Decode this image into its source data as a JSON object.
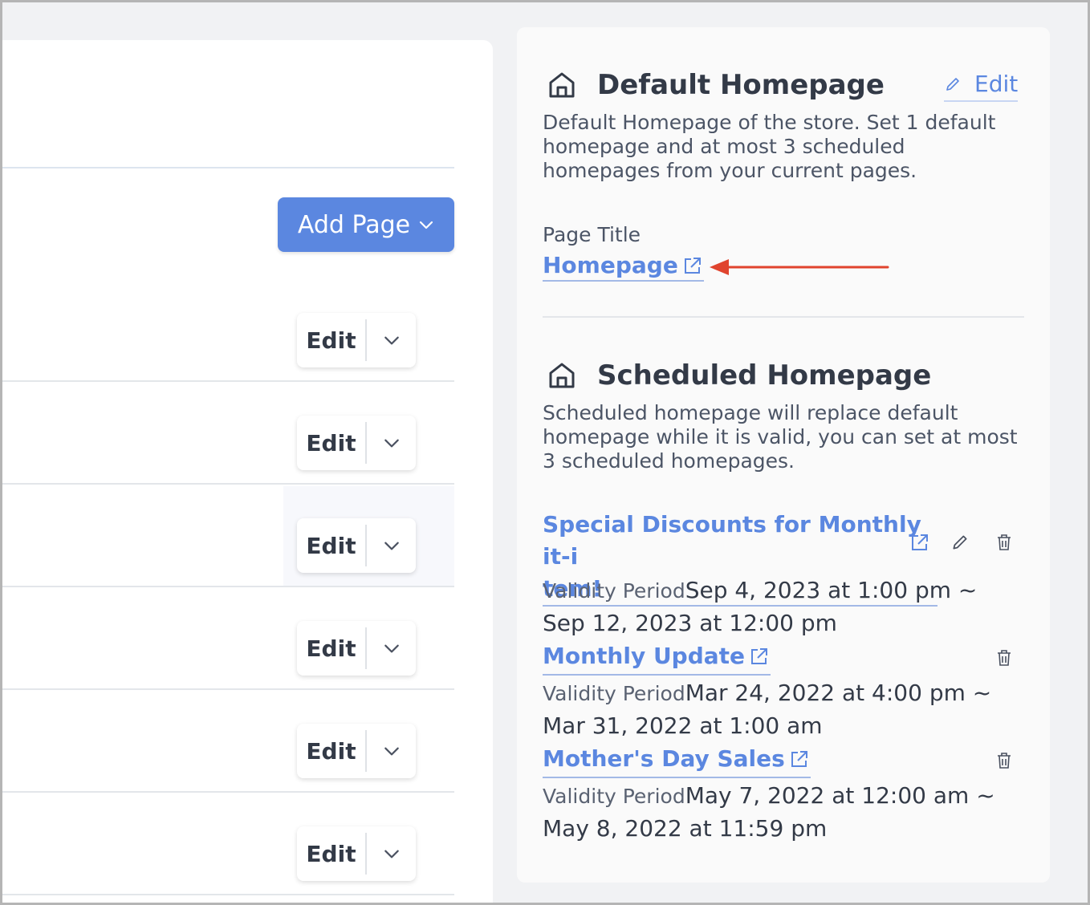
{
  "left": {
    "add_page_label": "Add Page",
    "rows": [
      {
        "edit_label": "Edit"
      },
      {
        "edit_label": "Edit"
      },
      {
        "edit_label": "Edit"
      },
      {
        "edit_label": "Edit"
      },
      {
        "edit_label": "Edit"
      },
      {
        "edit_label": "Edit"
      }
    ]
  },
  "default_homepage": {
    "title": "Default Homepage",
    "edit_label": "Edit",
    "description": "Default Homepage of the store. Set 1 default homepage and at most 3 scheduled homepages from your current pages.",
    "page_title_label": "Page Title",
    "page_link": "Homepage"
  },
  "scheduled_homepage": {
    "title": "Scheduled Homepage",
    "description": "Scheduled homepage will replace default homepage while it is valid, you can set at most 3 scheduled homepages.",
    "items": [
      {
        "name_line1": "Special Discounts for Monthly it-i",
        "name_line2": "tem!",
        "validity_label": "Validity Period",
        "validity": "Sep 4, 2023 at 1:00 pm ~ Sep 12, 2023 at 12:00 pm"
      },
      {
        "name": "Monthly Update",
        "validity_label": "Validity Period",
        "validity": "Mar 24, 2022 at 4:00 pm ~ Mar 31, 2022 at 1:00 am"
      },
      {
        "name": "Mother's Day Sales",
        "validity_label": "Validity Period",
        "validity": "May 7, 2022 at 12:00 am ~ May 8, 2022 at 11:59 pm"
      }
    ]
  },
  "colors": {
    "accent": "#5b87e0",
    "annotation_arrow": "#e0442e"
  }
}
